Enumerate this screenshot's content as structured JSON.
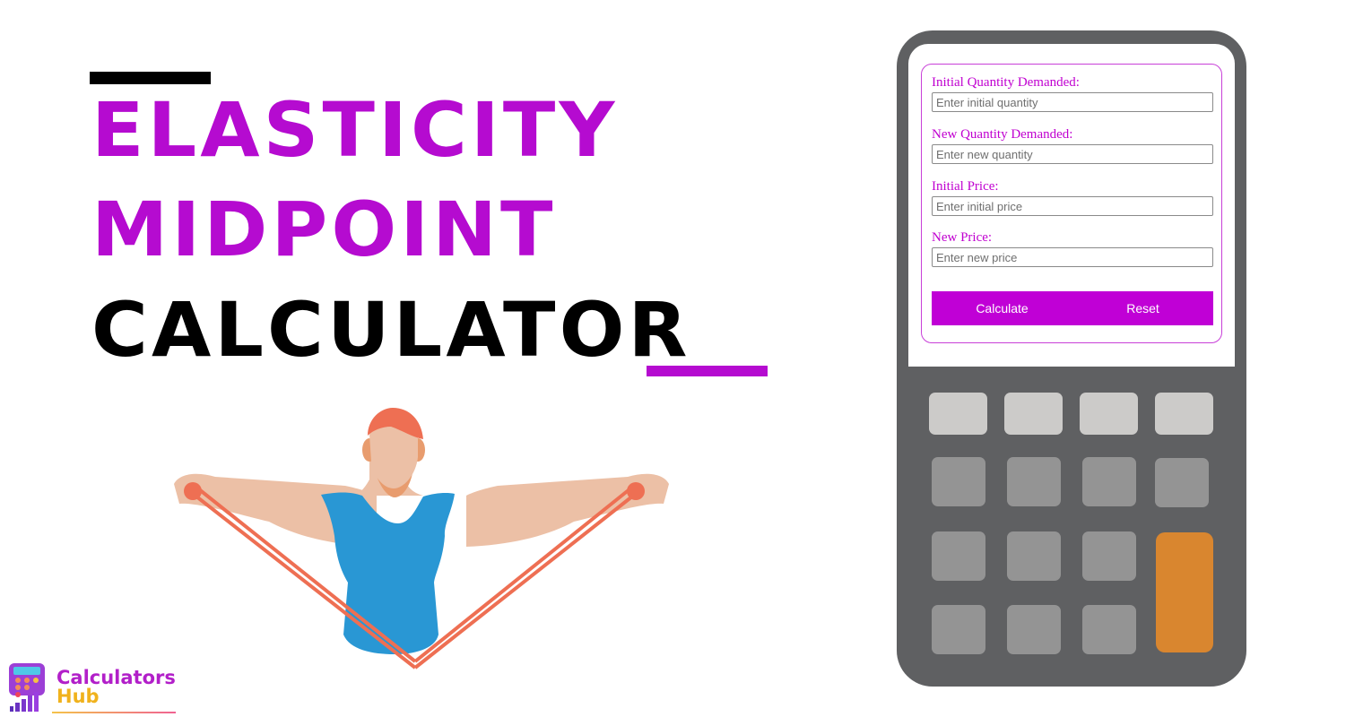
{
  "title": {
    "line1": "ELASTICITY",
    "line2": "MIDPOINT",
    "line3": "CALCULATOR"
  },
  "colors": {
    "accent": "#b50bd0",
    "button_bg": "#c000d6",
    "calc_body": "#5f6062",
    "key_light": "#cccbc9",
    "key_mid": "#949494",
    "key_orange": "#d9862f",
    "band": "#ee6f53",
    "shirt": "#2997d4",
    "skin": "#ecc0a6"
  },
  "form": {
    "fields": [
      {
        "label": "Initial Quantity Demanded:",
        "placeholder": "Enter initial quantity",
        "value": ""
      },
      {
        "label": "New Quantity Demanded:",
        "placeholder": "Enter new quantity",
        "value": ""
      },
      {
        "label": "Initial Price:",
        "placeholder": "Enter initial price",
        "value": ""
      },
      {
        "label": "New Price:",
        "placeholder": "Enter new price",
        "value": ""
      }
    ],
    "calculate_label": "Calculate",
    "reset_label": "Reset"
  },
  "logo": {
    "line1": "Calculators",
    "line2": "Hub"
  },
  "illustration": {
    "subject": "person-stretching-resistance-band"
  }
}
